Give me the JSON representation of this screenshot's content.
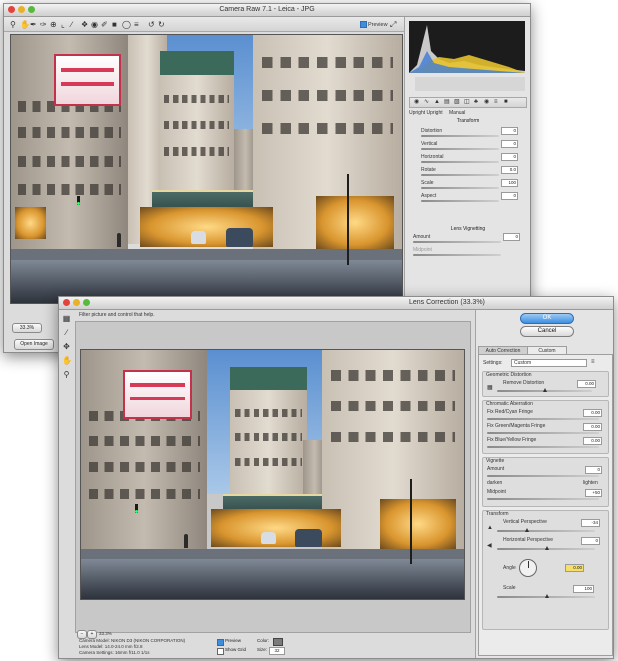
{
  "camera_raw": {
    "title": "Camera Raw 7.1 - Leica - JPG",
    "toolbar_icons": [
      "zoom-tool",
      "hand-tool",
      "white-balance-tool",
      "color-sampler-tool",
      "targeted-adjustment-tool",
      "crop-tool",
      "straighten-tool",
      "spot-removal-tool",
      "red-eye-tool",
      "adjustment-brush-tool",
      "graduated-filter-tool",
      "radial-filter-tool",
      "preferences-tool",
      "rotate-left-tool",
      "rotate-right-tool"
    ],
    "preview_label": "Preview",
    "panel_tab_labels": [
      "Upright Upright",
      "Manual"
    ],
    "transform_title": "Transform",
    "sliders": [
      {
        "label": "Distortion",
        "value": "0"
      },
      {
        "label": "Vertical",
        "value": "0"
      },
      {
        "label": "Horizontal",
        "value": "0"
      },
      {
        "label": "Rotate",
        "value": "0.0"
      },
      {
        "label": "Scale",
        "value": "100"
      },
      {
        "label": "Aspect",
        "value": "0"
      }
    ],
    "lens_vignetting_title": "Lens Vignetting",
    "vignette_sliders": [
      {
        "label": "Amount",
        "value": "0"
      },
      {
        "label": "Midpoint",
        "value": ""
      }
    ],
    "open_image_button": "Open Image",
    "zoom_value": "33.3%"
  },
  "lens_correction": {
    "title": "Lens Correction (33.3%)",
    "hint": "Filter picture and control that help.",
    "ok_label": "OK",
    "cancel_label": "Cancel",
    "tabs": [
      "Auto Correction",
      "Custom"
    ],
    "settings_label": "Settings:",
    "settings_value": "Custom",
    "geometric_distortion_title": "Geometric Distortion",
    "remove_distortion_label": "Remove Distortion",
    "remove_distortion_value": "0.00",
    "chromatic_title": "Chromatic Aberration",
    "chromatic_rows": [
      {
        "label": "Fix Red/Cyan Fringe",
        "value": "0.00"
      },
      {
        "label": "Fix Green/Magenta Fringe",
        "value": "0.00"
      },
      {
        "label": "Fix Blue/Yellow Fringe",
        "value": "0.00"
      }
    ],
    "vignette_title": "Vignette",
    "vignette_rows": [
      {
        "label": "Amount",
        "value": "0"
      },
      {
        "label": "darken",
        "value": "lighten"
      },
      {
        "label": "Midpoint",
        "value": "+50"
      }
    ],
    "transform_title": "Transform",
    "vertical_perspective_label": "Vertical Perspective",
    "vertical_perspective_value": "-34",
    "horizontal_perspective_label": "Horizontal Perspective",
    "horizontal_perspective_value": "0",
    "angle_label": "Angle",
    "angle_value": "0.00",
    "scale_label": "Scale",
    "scale_value": "100",
    "zoom_value": "33.3%",
    "status_lines": [
      "Camera Model: NIKON D3 (NIKON CORPORATION)",
      "Lens Model: 14.0-24.0 mm f/2.8",
      "Camera Settings: 16mm f/11.0 1/1s"
    ],
    "preview_label": "Preview",
    "show_grid_label": "Show Grid",
    "color_label": "Color:",
    "size_label": "Size:",
    "size_value": "32"
  },
  "colors": {
    "accent_blue": "#3e8ee0",
    "window_gray": "#dcdcdc",
    "canvas_gray": "#c8c8c8"
  }
}
